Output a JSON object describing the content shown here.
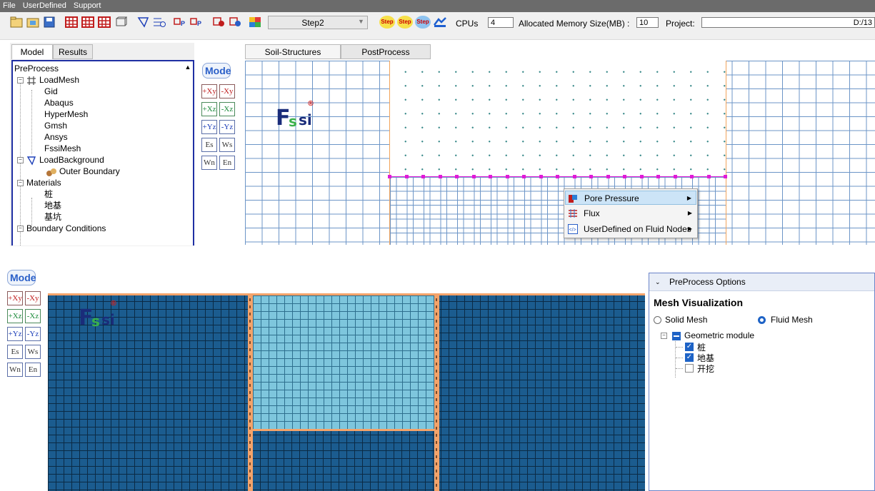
{
  "menubar": {
    "items": [
      "File",
      "UserDefined",
      "Support"
    ]
  },
  "toolbar": {
    "step_select": "Step2",
    "step_buttons": [
      "Step",
      "Step",
      "Step"
    ],
    "cpus_label": "CPUs",
    "cpus_value": "4",
    "memory_label": "Allocated Memory Size(MB) :",
    "memory_value": "10",
    "project_label": "Project:",
    "project_path": "D:/13"
  },
  "left_panel": {
    "tabs": [
      "Model",
      "Results"
    ],
    "tree": {
      "root": "PreProcess",
      "load_mesh": "LoadMesh",
      "mesh_items": [
        "Gid",
        "Abaqus",
        "HyperMesh",
        "Gmsh",
        "Ansys",
        "FssiMesh"
      ],
      "load_background": "LoadBackground",
      "outer_boundary": "Outer Boundary",
      "materials": "Materials",
      "material_items": [
        "桩",
        "地基",
        "基坑"
      ],
      "boundary_conditions": "Boundary Conditions"
    }
  },
  "view_buttons": {
    "mode": "Mode",
    "labels": [
      "+Xy",
      "-Xy",
      "+Xz",
      "-Xz",
      "+Yz",
      "-Yz",
      "Es",
      "Ws",
      "Wn",
      "En"
    ]
  },
  "main_tabs": [
    "Soil-Structures",
    "PostProcess"
  ],
  "logo": {
    "f": "F",
    "s": "s",
    "si": "si",
    "mark": "®"
  },
  "context_menu": {
    "items": [
      {
        "label": "Pore Pressure"
      },
      {
        "label": "Flux"
      },
      {
        "label": "UserDefined on Fluid Nodes"
      }
    ]
  },
  "options_panel": {
    "header": "PreProcess Options",
    "section_title": "Mesh Visualization",
    "radio_solid": "Solid Mesh",
    "radio_fluid": "Fluid Mesh",
    "selected": "Fluid Mesh",
    "tree_root": "Geometric module",
    "items": [
      {
        "label": "桩",
        "checked": true
      },
      {
        "label": "地基",
        "checked": true
      },
      {
        "label": "开挖",
        "checked": false
      }
    ]
  }
}
